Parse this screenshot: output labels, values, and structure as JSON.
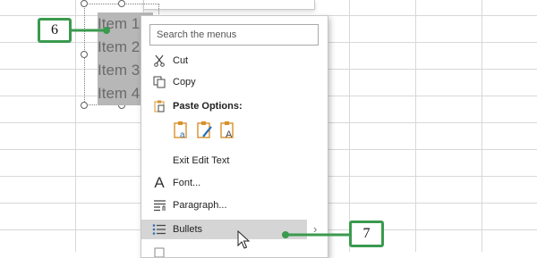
{
  "textbox": {
    "lines": [
      "Item 1",
      "Item 2",
      "Item 3",
      "Item 4"
    ]
  },
  "menu": {
    "search_placeholder": "Search the menus",
    "items": [
      {
        "label": "Cut",
        "icon": "scissors-icon"
      },
      {
        "label": "Copy",
        "icon": "copy-icon"
      },
      {
        "label": "Paste Options:",
        "icon": "clipboard-icon"
      },
      {
        "label": "Exit Edit Text",
        "icon": ""
      },
      {
        "label": "Font...",
        "icon": "font-icon"
      },
      {
        "label": "Paragraph...",
        "icon": "paragraph-icon"
      },
      {
        "label": "Bullets",
        "icon": "bullets-icon",
        "submenu_arrow": "›"
      }
    ],
    "paste_option_icons": [
      "paste-keep-formatting-icon",
      "paste-merge-formatting-icon",
      "paste-text-only-icon"
    ]
  },
  "callouts": [
    {
      "number": "6"
    },
    {
      "number": "7"
    }
  ],
  "colors": {
    "callout_green": "#3a9a4e",
    "highlight_row": "#d5d5d5",
    "text_highlight": "#b7b7b7",
    "paste_icon_orange": "#d9902a"
  }
}
